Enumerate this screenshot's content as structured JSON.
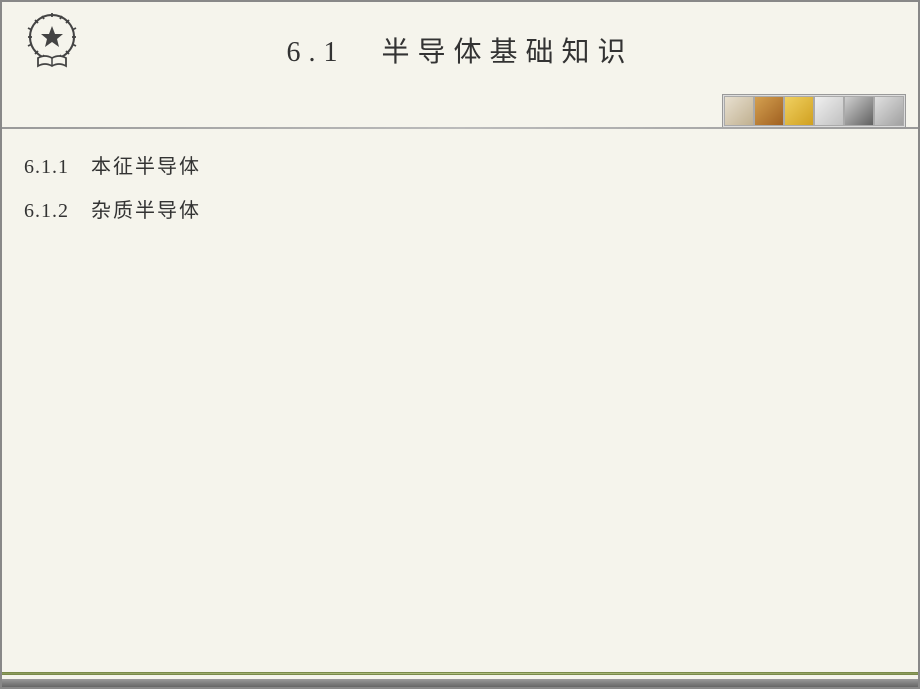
{
  "header": {
    "title": "6.1　半导体基础知识",
    "logo_name": "gear-star-book-emblem"
  },
  "toc": [
    {
      "num": "6.1.1",
      "label": "本征半导体"
    },
    {
      "num": "6.1.2",
      "label": "杂质半导体"
    }
  ],
  "icon_strip": [
    "decorative-tile-1",
    "decorative-tile-2",
    "decorative-tile-3",
    "decorative-tile-4",
    "decorative-tile-5",
    "decorative-tile-6"
  ]
}
